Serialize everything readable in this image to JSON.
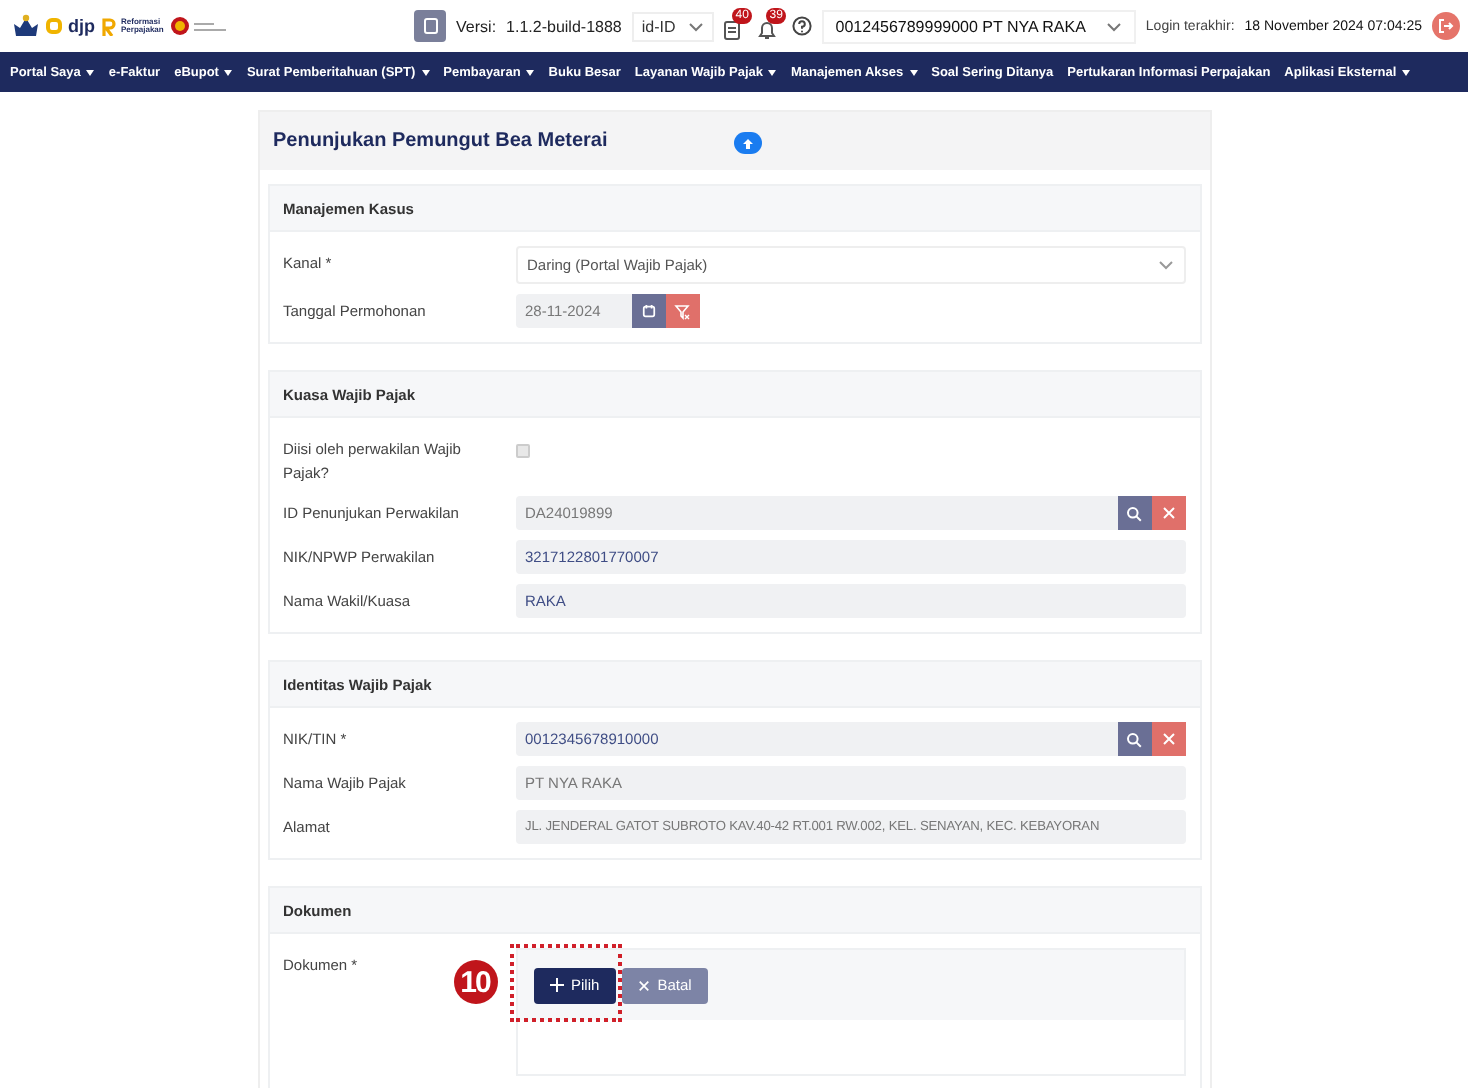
{
  "topbar": {
    "logo_text": "djp",
    "reform_logo": [
      "Reformasi",
      "Perpajakan"
    ],
    "version_label": "Versi:",
    "version": "1.1.2-build-1888",
    "language": "id-ID",
    "notifications": [
      {
        "kind": "document",
        "count": "40"
      },
      {
        "kind": "bell",
        "count": "39"
      }
    ],
    "account": "0012456789999000 PT NYA RAKA",
    "login_label": "Login terakhir:",
    "login_time": "18 November 2024 07:04:25"
  },
  "nav": [
    {
      "label": "Portal Saya",
      "dropdown": true
    },
    {
      "label": "e-Faktur",
      "dropdown": false
    },
    {
      "label": "eBupot",
      "dropdown": true
    },
    {
      "label": "Surat Pemberitahuan (SPT)",
      "dropdown": true
    },
    {
      "label": "Pembayaran",
      "dropdown": true
    },
    {
      "label": "Buku Besar",
      "dropdown": false
    },
    {
      "label": "Layanan Wajib Pajak",
      "dropdown": true
    },
    {
      "label": "Manajemen Akses",
      "dropdown": true
    },
    {
      "label": "Soal Sering Ditanya",
      "dropdown": false
    },
    {
      "label": "Pertukaran Informasi Perpajakan",
      "dropdown": false
    },
    {
      "label": "Aplikasi Eksternal",
      "dropdown": true
    }
  ],
  "page": {
    "title": "Penunjukan Pemungut Bea Meterai",
    "sections": [
      {
        "title": "Manajemen Kasus",
        "rows": [
          {
            "kind": "select",
            "label": "Kanal *",
            "value": "Daring (Portal Wajib Pajak)"
          },
          {
            "kind": "date",
            "label": "Tanggal Permohonan",
            "value": "28-11-2024"
          }
        ]
      },
      {
        "title": "Kuasa Wajib Pajak",
        "rows": [
          {
            "kind": "checkbox",
            "label": "Diisi oleh perwakilan Wajib Pajak?",
            "checked": false
          },
          {
            "kind": "lookup",
            "label": "ID Penunjukan Perwakilan",
            "value": "DA24019899",
            "highlight": false
          },
          {
            "kind": "readonly",
            "label": "NIK/NPWP Perwakilan",
            "value": "3217122801770007",
            "highlight": true
          },
          {
            "kind": "readonly",
            "label": "Nama Wakil/Kuasa",
            "value": "RAKA",
            "highlight": true
          }
        ]
      },
      {
        "title": "Identitas Wajib Pajak",
        "rows": [
          {
            "kind": "lookup",
            "label": "NIK/TIN *",
            "value": "0012345678910000",
            "highlight": true
          },
          {
            "kind": "readonly",
            "label": "Nama Wajib Pajak",
            "value": "PT NYA RAKA",
            "highlight": false
          },
          {
            "kind": "readonly",
            "label": "Alamat",
            "value": "JL. JENDERAL GATOT SUBROTO KAV.40-42 RT.001 RW.002, KEL. SENAYAN, KEC. KEBAYORAN",
            "highlight": false
          }
        ]
      },
      {
        "title": "Dokumen",
        "rows": [
          {
            "kind": "upload",
            "label": "Dokumen *",
            "step": "10",
            "buttons": [
              "Pilih",
              "Batal"
            ]
          }
        ]
      }
    ]
  }
}
